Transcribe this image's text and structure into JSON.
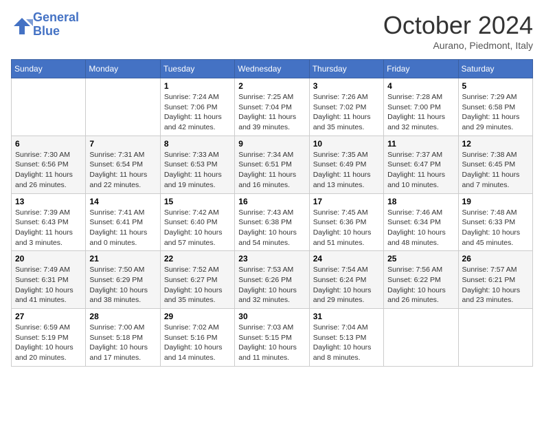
{
  "header": {
    "logo_line1": "General",
    "logo_line2": "Blue",
    "month": "October 2024",
    "location": "Aurano, Piedmont, Italy"
  },
  "days_of_week": [
    "Sunday",
    "Monday",
    "Tuesday",
    "Wednesday",
    "Thursday",
    "Friday",
    "Saturday"
  ],
  "weeks": [
    [
      {
        "day": "",
        "info": ""
      },
      {
        "day": "",
        "info": ""
      },
      {
        "day": "1",
        "info": "Sunrise: 7:24 AM\nSunset: 7:06 PM\nDaylight: 11 hours and 42 minutes."
      },
      {
        "day": "2",
        "info": "Sunrise: 7:25 AM\nSunset: 7:04 PM\nDaylight: 11 hours and 39 minutes."
      },
      {
        "day": "3",
        "info": "Sunrise: 7:26 AM\nSunset: 7:02 PM\nDaylight: 11 hours and 35 minutes."
      },
      {
        "day": "4",
        "info": "Sunrise: 7:28 AM\nSunset: 7:00 PM\nDaylight: 11 hours and 32 minutes."
      },
      {
        "day": "5",
        "info": "Sunrise: 7:29 AM\nSunset: 6:58 PM\nDaylight: 11 hours and 29 minutes."
      }
    ],
    [
      {
        "day": "6",
        "info": "Sunrise: 7:30 AM\nSunset: 6:56 PM\nDaylight: 11 hours and 26 minutes."
      },
      {
        "day": "7",
        "info": "Sunrise: 7:31 AM\nSunset: 6:54 PM\nDaylight: 11 hours and 22 minutes."
      },
      {
        "day": "8",
        "info": "Sunrise: 7:33 AM\nSunset: 6:53 PM\nDaylight: 11 hours and 19 minutes."
      },
      {
        "day": "9",
        "info": "Sunrise: 7:34 AM\nSunset: 6:51 PM\nDaylight: 11 hours and 16 minutes."
      },
      {
        "day": "10",
        "info": "Sunrise: 7:35 AM\nSunset: 6:49 PM\nDaylight: 11 hours and 13 minutes."
      },
      {
        "day": "11",
        "info": "Sunrise: 7:37 AM\nSunset: 6:47 PM\nDaylight: 11 hours and 10 minutes."
      },
      {
        "day": "12",
        "info": "Sunrise: 7:38 AM\nSunset: 6:45 PM\nDaylight: 11 hours and 7 minutes."
      }
    ],
    [
      {
        "day": "13",
        "info": "Sunrise: 7:39 AM\nSunset: 6:43 PM\nDaylight: 11 hours and 3 minutes."
      },
      {
        "day": "14",
        "info": "Sunrise: 7:41 AM\nSunset: 6:41 PM\nDaylight: 11 hours and 0 minutes."
      },
      {
        "day": "15",
        "info": "Sunrise: 7:42 AM\nSunset: 6:40 PM\nDaylight: 10 hours and 57 minutes."
      },
      {
        "day": "16",
        "info": "Sunrise: 7:43 AM\nSunset: 6:38 PM\nDaylight: 10 hours and 54 minutes."
      },
      {
        "day": "17",
        "info": "Sunrise: 7:45 AM\nSunset: 6:36 PM\nDaylight: 10 hours and 51 minutes."
      },
      {
        "day": "18",
        "info": "Sunrise: 7:46 AM\nSunset: 6:34 PM\nDaylight: 10 hours and 48 minutes."
      },
      {
        "day": "19",
        "info": "Sunrise: 7:48 AM\nSunset: 6:33 PM\nDaylight: 10 hours and 45 minutes."
      }
    ],
    [
      {
        "day": "20",
        "info": "Sunrise: 7:49 AM\nSunset: 6:31 PM\nDaylight: 10 hours and 41 minutes."
      },
      {
        "day": "21",
        "info": "Sunrise: 7:50 AM\nSunset: 6:29 PM\nDaylight: 10 hours and 38 minutes."
      },
      {
        "day": "22",
        "info": "Sunrise: 7:52 AM\nSunset: 6:27 PM\nDaylight: 10 hours and 35 minutes."
      },
      {
        "day": "23",
        "info": "Sunrise: 7:53 AM\nSunset: 6:26 PM\nDaylight: 10 hours and 32 minutes."
      },
      {
        "day": "24",
        "info": "Sunrise: 7:54 AM\nSunset: 6:24 PM\nDaylight: 10 hours and 29 minutes."
      },
      {
        "day": "25",
        "info": "Sunrise: 7:56 AM\nSunset: 6:22 PM\nDaylight: 10 hours and 26 minutes."
      },
      {
        "day": "26",
        "info": "Sunrise: 7:57 AM\nSunset: 6:21 PM\nDaylight: 10 hours and 23 minutes."
      }
    ],
    [
      {
        "day": "27",
        "info": "Sunrise: 6:59 AM\nSunset: 5:19 PM\nDaylight: 10 hours and 20 minutes."
      },
      {
        "day": "28",
        "info": "Sunrise: 7:00 AM\nSunset: 5:18 PM\nDaylight: 10 hours and 17 minutes."
      },
      {
        "day": "29",
        "info": "Sunrise: 7:02 AM\nSunset: 5:16 PM\nDaylight: 10 hours and 14 minutes."
      },
      {
        "day": "30",
        "info": "Sunrise: 7:03 AM\nSunset: 5:15 PM\nDaylight: 10 hours and 11 minutes."
      },
      {
        "day": "31",
        "info": "Sunrise: 7:04 AM\nSunset: 5:13 PM\nDaylight: 10 hours and 8 minutes."
      },
      {
        "day": "",
        "info": ""
      },
      {
        "day": "",
        "info": ""
      }
    ]
  ]
}
